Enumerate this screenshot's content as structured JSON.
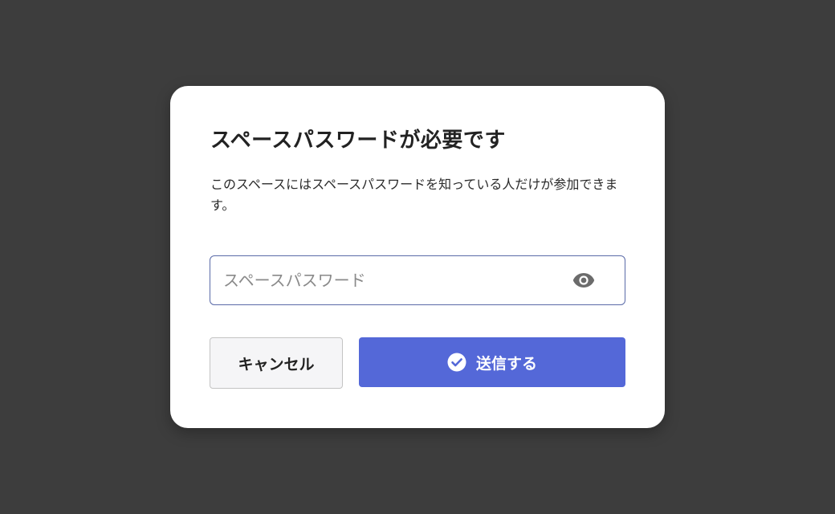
{
  "dialog": {
    "title": "スペースパスワードが必要です",
    "description": "このスペースにはスペースパスワードを知っている人だけが参加できます。",
    "password": {
      "value": "",
      "placeholder": "スペースパスワード",
      "toggle_icon": "eye-icon"
    },
    "buttons": {
      "cancel_label": "キャンセル",
      "submit_label": "送信する",
      "submit_icon": "check-circle-icon"
    }
  },
  "colors": {
    "backdrop": "#3d3d3d",
    "dialog_bg": "#ffffff",
    "primary": "#5468d8",
    "input_border": "#5a6aa8",
    "cancel_bg": "#f5f5f7"
  }
}
